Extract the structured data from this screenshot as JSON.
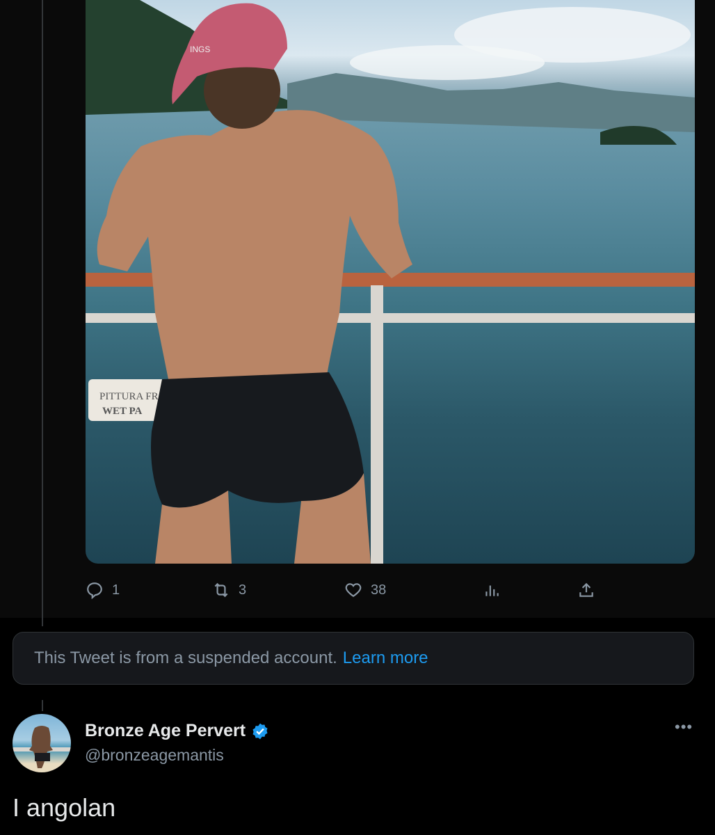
{
  "top_tweet": {
    "media": {
      "description_icon": "photo",
      "sign_text_1": "PITTURA FR",
      "sign_text_2": "WET PA",
      "cap_text": "INGS"
    },
    "actions": {
      "reply_count": "1",
      "retweet_count": "3",
      "like_count": "38"
    }
  },
  "suspended_notice": {
    "text": "This Tweet is from a suspended account.",
    "link": "Learn more"
  },
  "reply": {
    "author_name": "Bronze Age Pervert",
    "handle": "@bronzeagemantis",
    "text": "I angolan",
    "more": "•••"
  },
  "colors": {
    "link": "#1d9bf0",
    "muted": "#8b98a5",
    "verified": "#1d9bf0"
  }
}
